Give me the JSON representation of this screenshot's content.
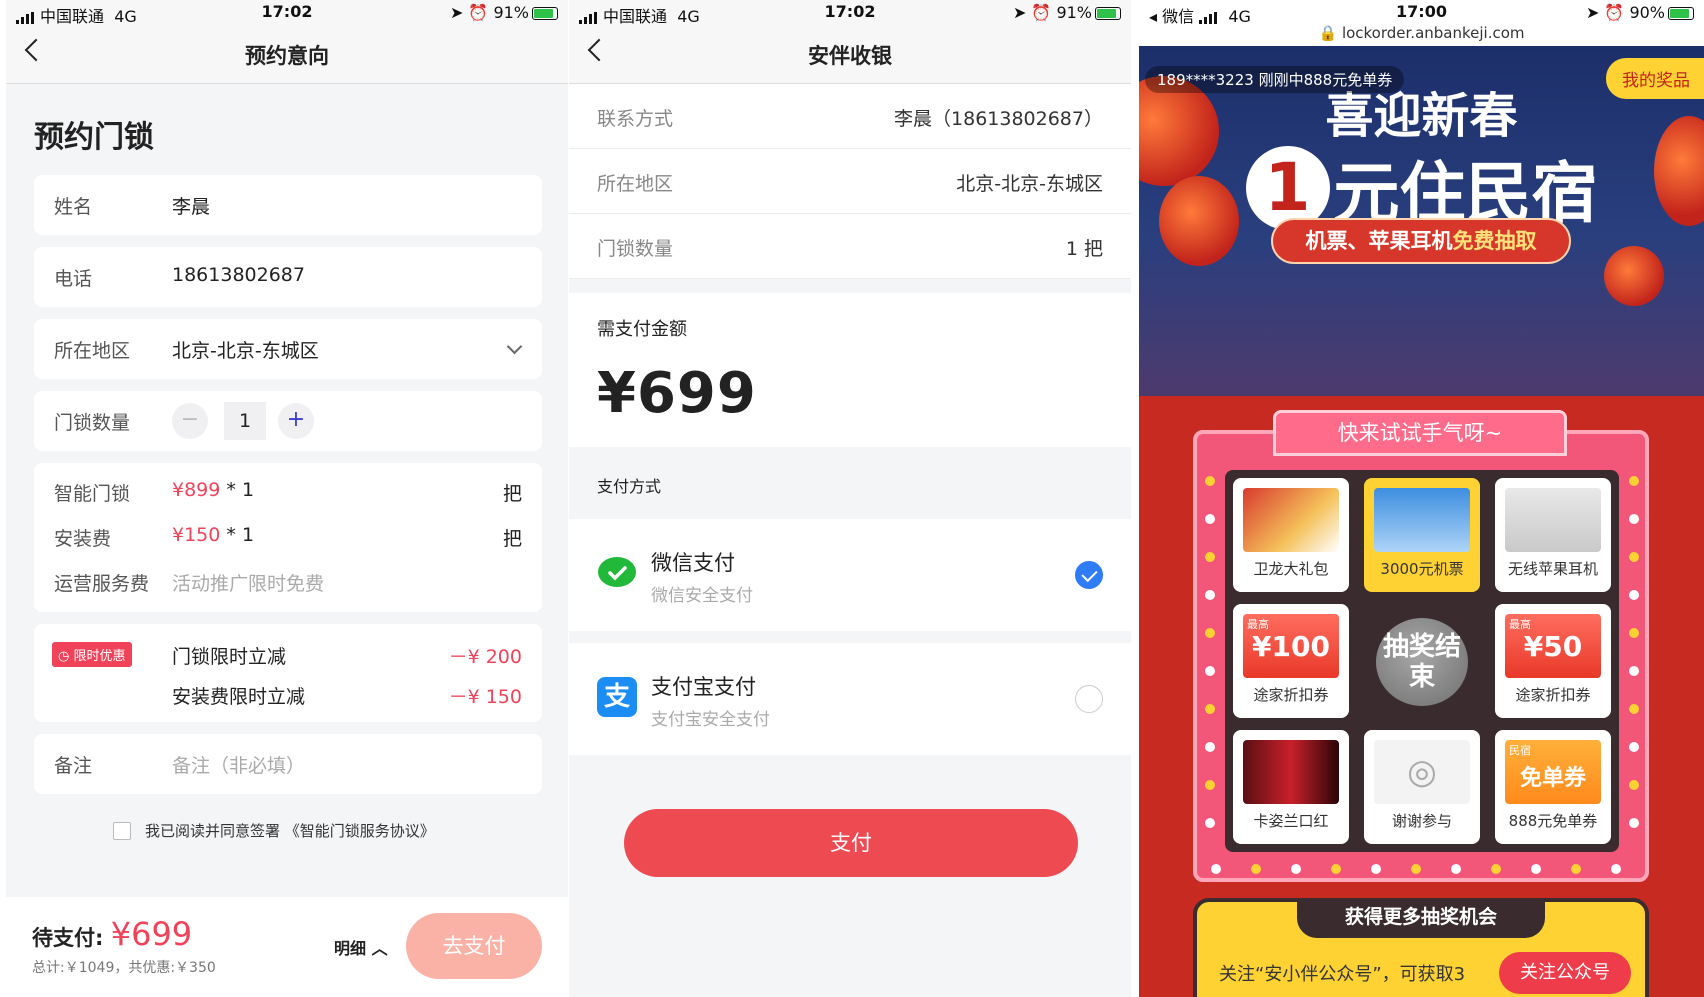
{
  "p1": {
    "status": {
      "carrier": "中国联通",
      "net": "4G",
      "time": "17:02",
      "battery": "91%"
    },
    "title": "预约意向",
    "heading": "预约门锁",
    "name_label": "姓名",
    "name_value": "李晨",
    "phone_label": "电话",
    "phone_value": "18613802687",
    "area_label": "所在地区",
    "area_value": "北京-北京-东城区",
    "qty_label": "门锁数量",
    "qty_minus": "−",
    "qty_value": "1",
    "qty_plus": "+",
    "price_rows": [
      {
        "label": "智能门锁",
        "price": "¥899",
        "mult": " * 1",
        "unit": "把"
      },
      {
        "label": "安装费",
        "price": "¥150",
        "mult": " * 1",
        "unit": "把"
      },
      {
        "label": "运营服务费",
        "price": "活动推广限时免费",
        "mult": "",
        "unit": ""
      }
    ],
    "promo_badge": "限时优惠",
    "discounts": [
      {
        "label": "门锁限时立减",
        "value": "－¥ 200"
      },
      {
        "label": "安装费限时立减",
        "value": "－¥ 150"
      }
    ],
    "note_label": "备注",
    "note_placeholder": "备注（非必填）",
    "agree_text": "我已阅读并同意签署 《智能门锁服务协议》",
    "pending_label": "待支付:",
    "pending_amount": "¥699",
    "total_text": "总计:￥1049，共优惠:￥350",
    "detail_label": "明细",
    "go_pay": "去支付"
  },
  "p2": {
    "status": {
      "carrier": "中国联通",
      "net": "4G",
      "time": "17:02",
      "battery": "91%"
    },
    "title": "安伴收银",
    "rows": [
      {
        "k": "联系方式",
        "v": "李晨（18613802687）"
      },
      {
        "k": "所在地区",
        "v": "北京-北京-东城区"
      },
      {
        "k": "门锁数量",
        "v": "1 把"
      }
    ],
    "amount_label": "需支付金额",
    "amount": "¥699",
    "method_label": "支付方式",
    "wechat_title": "微信支付",
    "wechat_sub": "微信安全支付",
    "alipay_title": "支付宝支付",
    "alipay_sub": "支付宝安全支付",
    "pay": "支付"
  },
  "p3": {
    "status": {
      "back_app": "微信",
      "net": "4G",
      "time": "17:00",
      "battery": "90%"
    },
    "url": "lockorder.anbankeji.com",
    "ticker": "189****3223 刚刚中888元免单券",
    "my_prizes": "我的奖品",
    "headline1": "喜迎新春",
    "headline_num": "1",
    "headline2": "元住民宿",
    "pill_a": "机票、苹果耳机",
    "pill_b": "免费抽取",
    "try_banner": "快来试试手气呀~",
    "cells": [
      {
        "cap": "卫龙大礼包"
      },
      {
        "cap": "3000元机票"
      },
      {
        "cap": "无线苹果耳机"
      },
      {
        "cap": "途家折扣券",
        "small": "最高",
        "big": "¥100"
      },
      {
        "center": "抽奖结束"
      },
      {
        "cap": "途家折扣券",
        "small": "最高",
        "big": "¥50"
      },
      {
        "cap": "卡姿兰口红"
      },
      {
        "cap": "谢谢参与"
      },
      {
        "cap": "888元免单券",
        "small": "民宿",
        "big": "免单券"
      }
    ],
    "more_title": "获得更多抽奖机会",
    "more_desc": "关注“安小伴公众号”，可获取3",
    "follow": "关注公众号"
  }
}
